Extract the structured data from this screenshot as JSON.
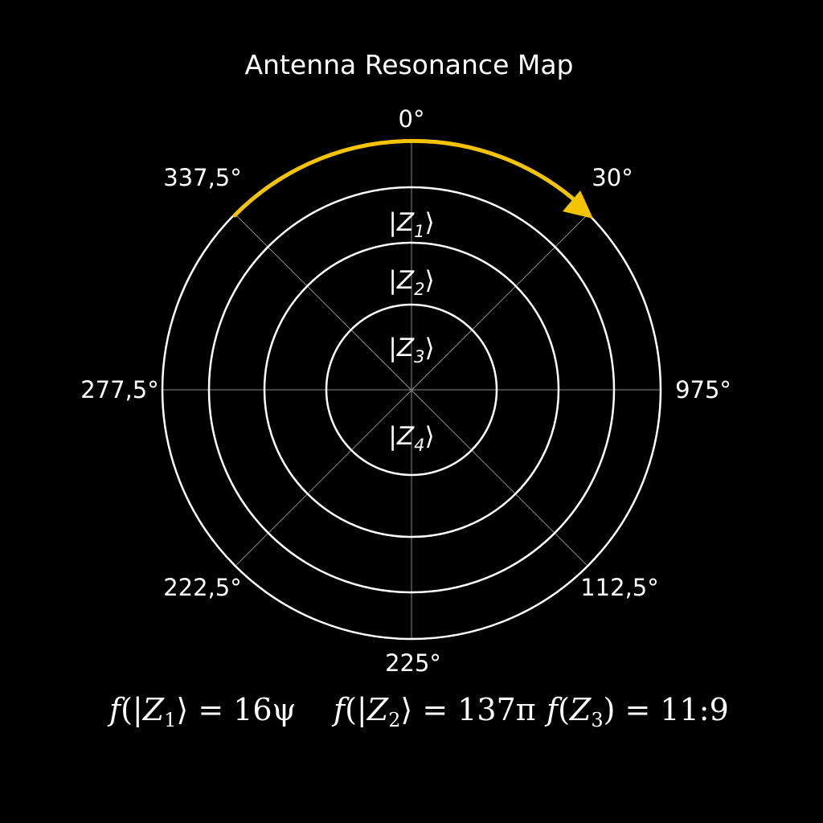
{
  "title": "Antenna Resonance Map",
  "colors": {
    "background": "#000000",
    "foreground": "#ffffff",
    "accent_arc": "#f5c400",
    "spokes": "#8a8a8a"
  },
  "angle_labels": {
    "top": "0°",
    "top_right": "30°",
    "right": "975°",
    "bottom_right": "112,5°",
    "bottom": "225°",
    "bottom_left": "222,5°",
    "left": "277,5°",
    "top_left": "337,5°"
  },
  "states": [
    {
      "open": "|",
      "letter": "Z",
      "sub": "1",
      "close": "⟩"
    },
    {
      "open": "|",
      "letter": "Z",
      "sub": "2",
      "close": "⟩"
    },
    {
      "open": "|",
      "letter": "Z",
      "sub": "3",
      "close": "⟩"
    },
    {
      "open": "|",
      "letter": "Z",
      "sub": "4",
      "close": "⟩"
    }
  ],
  "formulas": [
    {
      "f": "f",
      "open": "(|",
      "letter": "Z",
      "sub": "1",
      "close": "⟩",
      "eq": " = ",
      "value": "16ψ"
    },
    {
      "f": "f",
      "open": "(|",
      "letter": "Z",
      "sub": "2",
      "close": "⟩",
      "eq": " = ",
      "value": "137π"
    },
    {
      "f": "f",
      "open": "(",
      "letter": "Z",
      "sub": "3",
      "close": ")",
      "eq": " = ",
      "value": "11:9"
    }
  ],
  "accent_arc": {
    "from_angle_label": "337,5°",
    "to_angle_label": "30°",
    "direction": "clockwise"
  }
}
